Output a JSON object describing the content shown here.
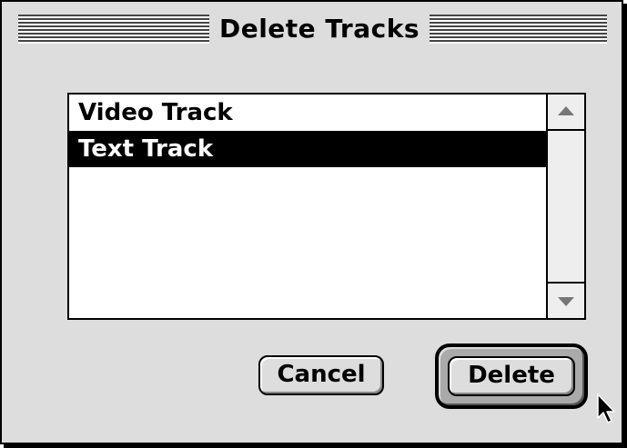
{
  "dialog": {
    "title": "Delete Tracks"
  },
  "tracks": {
    "items": [
      {
        "label": "Video Track",
        "selected": false
      },
      {
        "label": "Text Track",
        "selected": true
      }
    ]
  },
  "buttons": {
    "cancel_label": "Cancel",
    "delete_label": "Delete",
    "default_button": "Delete"
  },
  "icons": {
    "scroll_up": "scroll-up-arrow-icon",
    "scroll_down": "scroll-down-arrow-icon",
    "cursor": "mouse-pointer-icon"
  },
  "colors": {
    "selection_background": "#000000",
    "selection_text": "#ffffff",
    "window_background": "#dddddd"
  }
}
